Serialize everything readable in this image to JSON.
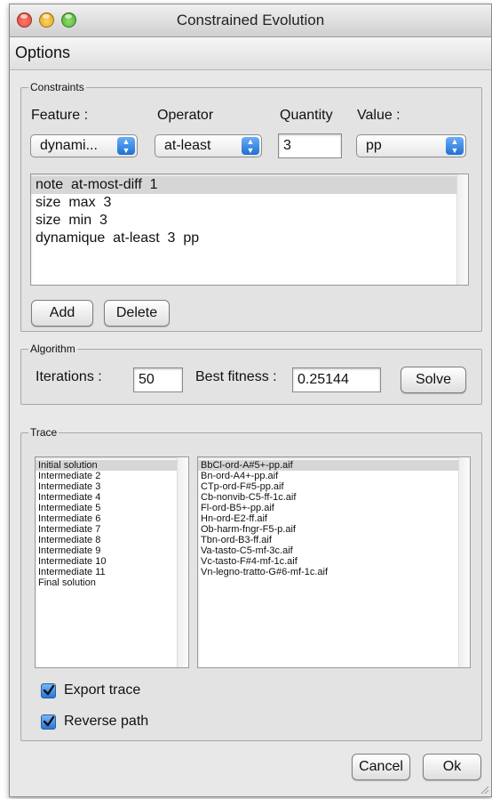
{
  "window": {
    "title": "Constrained Evolution"
  },
  "menu": {
    "options_label": "Options"
  },
  "constraints": {
    "legend": "Constraints",
    "feature_label": "Feature :",
    "operator_label": "Operator",
    "quantity_label": "Quantity",
    "value_label": "Value :",
    "feature_value": "dynami...",
    "operator_value": "at-least",
    "quantity_value": "3",
    "value_value": "pp",
    "rows": [
      "note  at-most-diff  1",
      "size  max  3",
      "size  min  3",
      "dynamique  at-least  3  pp"
    ],
    "add_label": "Add",
    "delete_label": "Delete"
  },
  "algorithm": {
    "legend": "Algorithm",
    "iterations_label": "Iterations :",
    "iterations_value": "50",
    "best_fitness_label": "Best fitness :",
    "best_fitness_value": "0.25144",
    "solve_label": "Solve"
  },
  "trace": {
    "legend": "Trace",
    "steps": [
      "Initial solution",
      "Intermediate 2",
      "Intermediate 3",
      "Intermediate 4",
      "Intermediate 5",
      "Intermediate 6",
      "Intermediate 7",
      "Intermediate 8",
      "Intermediate 9",
      "Intermediate 10",
      "Intermediate 11",
      "Final solution"
    ],
    "files": [
      "BbCl-ord-A#5+-pp.aif",
      "Bn-ord-A4+-pp.aif",
      "CTp-ord-F#5-pp.aif",
      "Cb-nonvib-C5-ff-1c.aif",
      "Fl-ord-B5+-pp.aif",
      "Hn-ord-E2-ff.aif",
      "Ob-harm-fngr-F5-p.aif",
      "Tbn-ord-B3-ff.aif",
      "Va-tasto-C5-mf-3c.aif",
      "Vc-tasto-F#4-mf-1c.aif",
      "Vn-legno-tratto-G#6-mf-1c.aif"
    ],
    "export_trace_label": "Export trace",
    "export_trace_checked": true,
    "reverse_path_label": "Reverse path",
    "reverse_path_checked": true
  },
  "footer": {
    "cancel_label": "Cancel",
    "ok_label": "Ok"
  },
  "colors": {
    "accent": "#2a76d8",
    "window_bg": "#e8e8e8",
    "selection": "#d6d6d6"
  }
}
